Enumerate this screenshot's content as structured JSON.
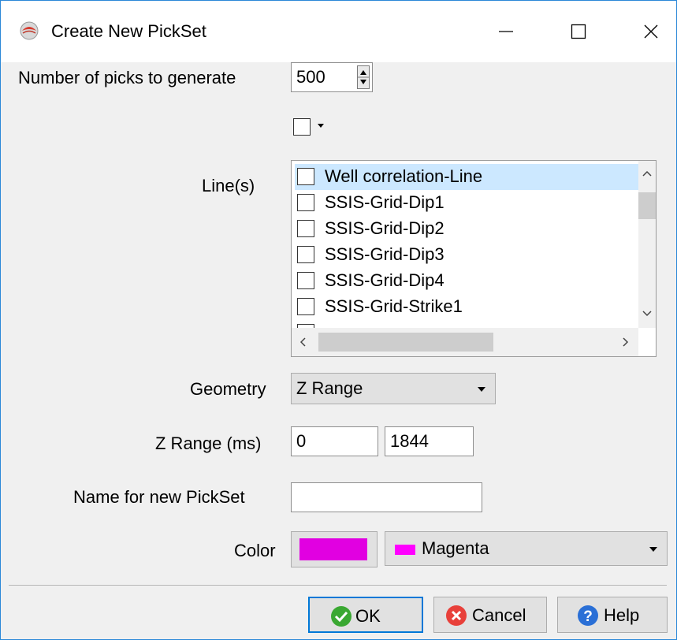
{
  "window": {
    "title": "Create New PickSet",
    "app_icon": "opendtect-icon",
    "controls": [
      "minimize-icon",
      "maximize-icon",
      "close-icon"
    ]
  },
  "form": {
    "num_picks_label": "Number of picks to generate",
    "num_picks_value": "500",
    "lines_label": "Line(s)",
    "lines": [
      {
        "label": "Well correlation-Line",
        "checked": false,
        "selected": true
      },
      {
        "label": "SSIS-Grid-Dip1",
        "checked": false
      },
      {
        "label": "SSIS-Grid-Dip2",
        "checked": false
      },
      {
        "label": "SSIS-Grid-Dip3",
        "checked": false
      },
      {
        "label": "SSIS-Grid-Dip4",
        "checked": false
      },
      {
        "label": "SSIS-Grid-Strike1",
        "checked": false
      }
    ],
    "geometry_label": "Geometry",
    "geometry_value": "Z Range",
    "zrange_label": "Z Range (ms)",
    "zrange_start": "0",
    "zrange_stop": "1844",
    "name_label": "Name for new PickSet",
    "name_value": "",
    "color_label": "Color",
    "color_value": "Magenta",
    "color_hex": "#ff00ff"
  },
  "buttons": {
    "ok": "OK",
    "cancel": "Cancel",
    "help": "Help"
  }
}
